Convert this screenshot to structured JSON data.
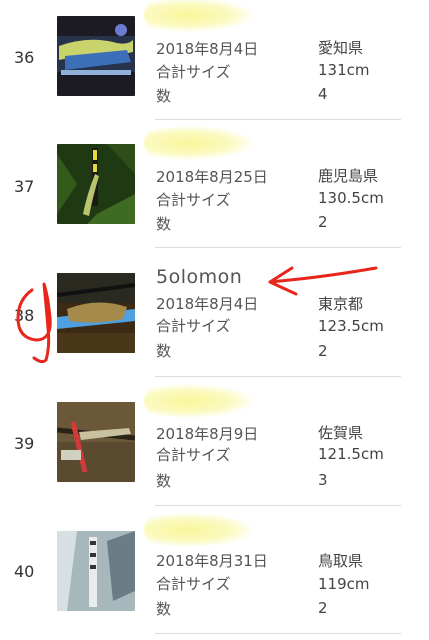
{
  "ranking": {
    "entries": [
      {
        "rank": "36",
        "name": "",
        "date": "2018年8月4日",
        "size_label": "合計サイズ",
        "count_label": "数",
        "prefecture": "愛知県",
        "size": "131cm",
        "count": "4"
      },
      {
        "rank": "37",
        "name": "",
        "date": "2018年8月25日",
        "size_label": "合計サイズ",
        "count_label": "数",
        "prefecture": "鹿児島県",
        "size": "130.5cm",
        "count": "2"
      },
      {
        "rank": "38",
        "name": "5olomon",
        "date": "2018年8月4日",
        "size_label": "合計サイズ",
        "count_label": "数",
        "prefecture": "東京都",
        "size": "123.5cm",
        "count": "2"
      },
      {
        "rank": "39",
        "name": "",
        "date": "2018年8月9日",
        "size_label": "合計サイズ",
        "count_label": "数",
        "prefecture": "佐賀県",
        "size": "121.5cm",
        "count": "3"
      },
      {
        "rank": "40",
        "name": "",
        "date": "2018年8月31日",
        "size_label": "合計サイズ",
        "count_label": "数",
        "prefecture": "鳥取県",
        "size": "119cm",
        "count": "2"
      }
    ]
  },
  "colors": {
    "annotation_red": "#e8261c",
    "name_blur": "#f7f39a"
  }
}
